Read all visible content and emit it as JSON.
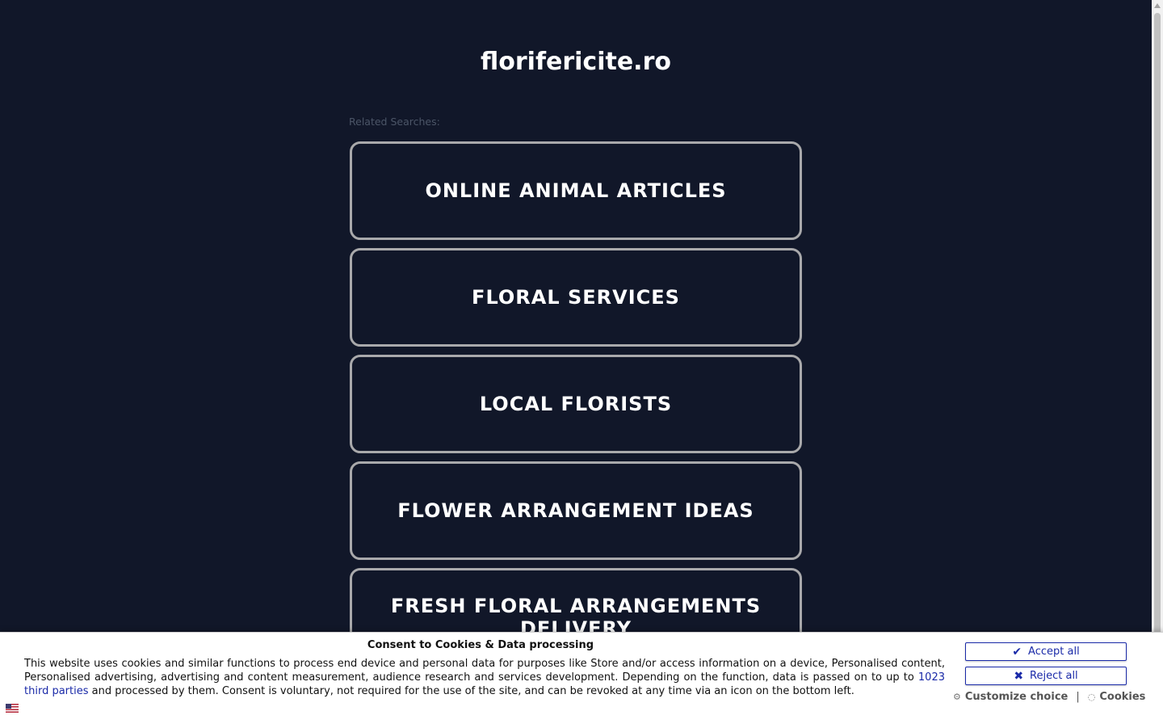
{
  "site": {
    "title": "florifericite.ro",
    "related_label": "Related Searches:",
    "searches": [
      "ONLINE ANIMAL ARTICLES",
      "FLORAL SERVICES",
      "LOCAL FLORISTS",
      "FLOWER ARRANGEMENT IDEAS",
      "FRESH FLORAL ARRANGEMENTS DELIVERY"
    ]
  },
  "consent": {
    "title": "Consent to Cookies & Data processing",
    "text_before_link": "This website uses cookies and similar functions to process end device and personal data for purposes like Store and/or access information on a device, Personalised content, Personalised advertising, advertising and content measurement, audience research and services development. Depending on the function, data is passed on to up to ",
    "link_text": "1023 third parties",
    "text_after_link": " and processed by them. Consent is voluntary, not required for the use of the site, and can be revoked at any time via an icon on the bottom left.",
    "accept_label": "Accept all",
    "reject_label": "Reject all",
    "customize_label": "Customize choice",
    "separator": "|",
    "cookies_label": "Cookies"
  },
  "icons": {
    "accept": "check-icon",
    "reject": "x-icon",
    "customize": "gear-icon",
    "cookies": "cookie-icon",
    "language": "us-flag-icon"
  },
  "colors": {
    "background": "#111729",
    "card_border": "#a9a9ab",
    "accent": "#1a2aa8"
  }
}
